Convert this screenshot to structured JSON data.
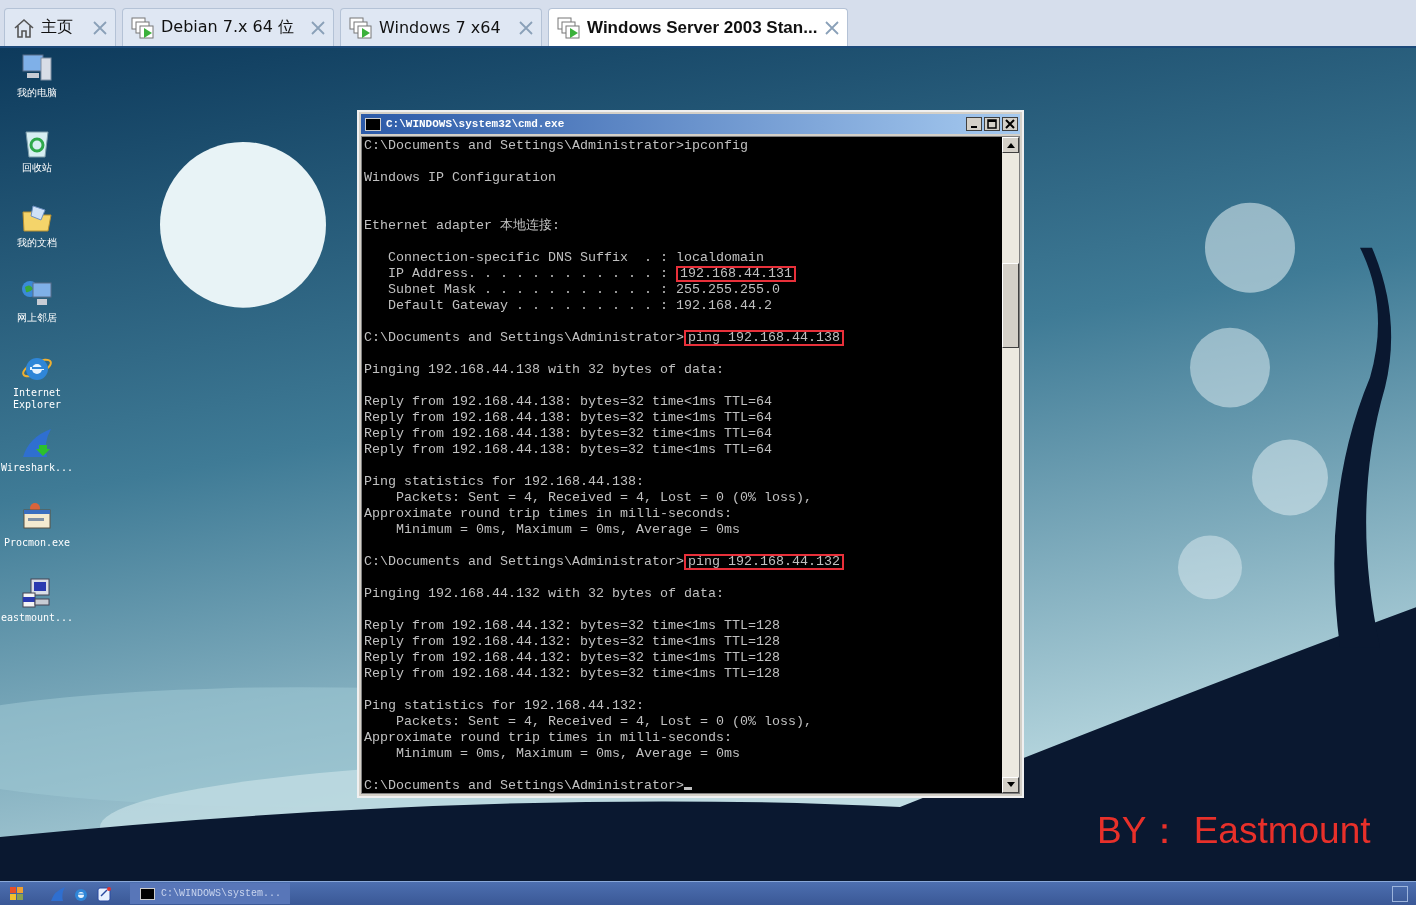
{
  "tabs": [
    {
      "label": "主页",
      "kind": "home",
      "selected": false
    },
    {
      "label": "Debian 7.x 64 位",
      "kind": "vm",
      "selected": false
    },
    {
      "label": "Windows 7 x64",
      "kind": "vm",
      "selected": false
    },
    {
      "label": "Windows Server 2003 Stan...",
      "kind": "vm",
      "selected": true
    }
  ],
  "desktop_icons": [
    {
      "label": "我的电脑",
      "kind": "computer"
    },
    {
      "label": "回收站",
      "kind": "recycle"
    },
    {
      "label": "我的文档",
      "kind": "folder"
    },
    {
      "label": "网上邻居",
      "kind": "network"
    },
    {
      "label": "Internet Explorer",
      "kind": "ie"
    },
    {
      "label": "Wireshark...",
      "kind": "shark"
    },
    {
      "label": "Procmon.exe",
      "kind": "window"
    },
    {
      "label": "eastmount...",
      "kind": "installer"
    }
  ],
  "console_window": {
    "title": "C:\\WINDOWS\\system32\\cmd.exe",
    "lines": [
      {
        "kind": "text",
        "text": "C:\\Documents and Settings\\Administrator>ipconfig"
      },
      {
        "kind": "blank"
      },
      {
        "kind": "text",
        "text": "Windows IP Configuration"
      },
      {
        "kind": "blank"
      },
      {
        "kind": "blank"
      },
      {
        "kind": "text",
        "text": "Ethernet adapter 本地连接:"
      },
      {
        "kind": "blank"
      },
      {
        "kind": "text",
        "text": "   Connection-specific DNS Suffix  . : localdomain"
      },
      {
        "kind": "text",
        "text": "   IP Address. . . . . . . . . . . . : ",
        "boxed": "192.168.44.131"
      },
      {
        "kind": "text",
        "text": "   Subnet Mask . . . . . . . . . . . : 255.255.255.0"
      },
      {
        "kind": "text",
        "text": "   Default Gateway . . . . . . . . . : 192.168.44.2"
      },
      {
        "kind": "blank"
      },
      {
        "kind": "text",
        "text": "C:\\Documents and Settings\\Administrator>",
        "boxed": "ping 192.168.44.138"
      },
      {
        "kind": "blank"
      },
      {
        "kind": "text",
        "text": "Pinging 192.168.44.138 with 32 bytes of data:"
      },
      {
        "kind": "blank"
      },
      {
        "kind": "text",
        "text": "Reply from 192.168.44.138: bytes=32 time<1ms TTL=64"
      },
      {
        "kind": "text",
        "text": "Reply from 192.168.44.138: bytes=32 time<1ms TTL=64"
      },
      {
        "kind": "text",
        "text": "Reply from 192.168.44.138: bytes=32 time<1ms TTL=64"
      },
      {
        "kind": "text",
        "text": "Reply from 192.168.44.138: bytes=32 time<1ms TTL=64"
      },
      {
        "kind": "blank"
      },
      {
        "kind": "text",
        "text": "Ping statistics for 192.168.44.138:"
      },
      {
        "kind": "text",
        "text": "    Packets: Sent = 4, Received = 4, Lost = 0 (0% loss),"
      },
      {
        "kind": "text",
        "text": "Approximate round trip times in milli-seconds:"
      },
      {
        "kind": "text",
        "text": "    Minimum = 0ms, Maximum = 0ms, Average = 0ms"
      },
      {
        "kind": "blank"
      },
      {
        "kind": "text",
        "text": "C:\\Documents and Settings\\Administrator>",
        "boxed": "ping 192.168.44.132"
      },
      {
        "kind": "blank"
      },
      {
        "kind": "text",
        "text": "Pinging 192.168.44.132 with 32 bytes of data:"
      },
      {
        "kind": "blank"
      },
      {
        "kind": "text",
        "text": "Reply from 192.168.44.132: bytes=32 time<1ms TTL=128"
      },
      {
        "kind": "text",
        "text": "Reply from 192.168.44.132: bytes=32 time<1ms TTL=128"
      },
      {
        "kind": "text",
        "text": "Reply from 192.168.44.132: bytes=32 time<1ms TTL=128"
      },
      {
        "kind": "text",
        "text": "Reply from 192.168.44.132: bytes=32 time<1ms TTL=128"
      },
      {
        "kind": "blank"
      },
      {
        "kind": "text",
        "text": "Ping statistics for 192.168.44.132:"
      },
      {
        "kind": "text",
        "text": "    Packets: Sent = 4, Received = 4, Lost = 0 (0% loss),"
      },
      {
        "kind": "text",
        "text": "Approximate round trip times in milli-seconds:"
      },
      {
        "kind": "text",
        "text": "    Minimum = 0ms, Maximum = 0ms, Average = 0ms"
      },
      {
        "kind": "blank"
      },
      {
        "kind": "text",
        "text": "C:\\Documents and Settings\\Administrator>",
        "cursor": true
      }
    ]
  },
  "annotation": "BY： Eastmount",
  "taskbar": {
    "quick_launch": [
      {
        "kind": "shark"
      },
      {
        "kind": "ie"
      },
      {
        "kind": "notepad"
      }
    ],
    "task_button": "C:\\WINDOWS\\system..."
  }
}
